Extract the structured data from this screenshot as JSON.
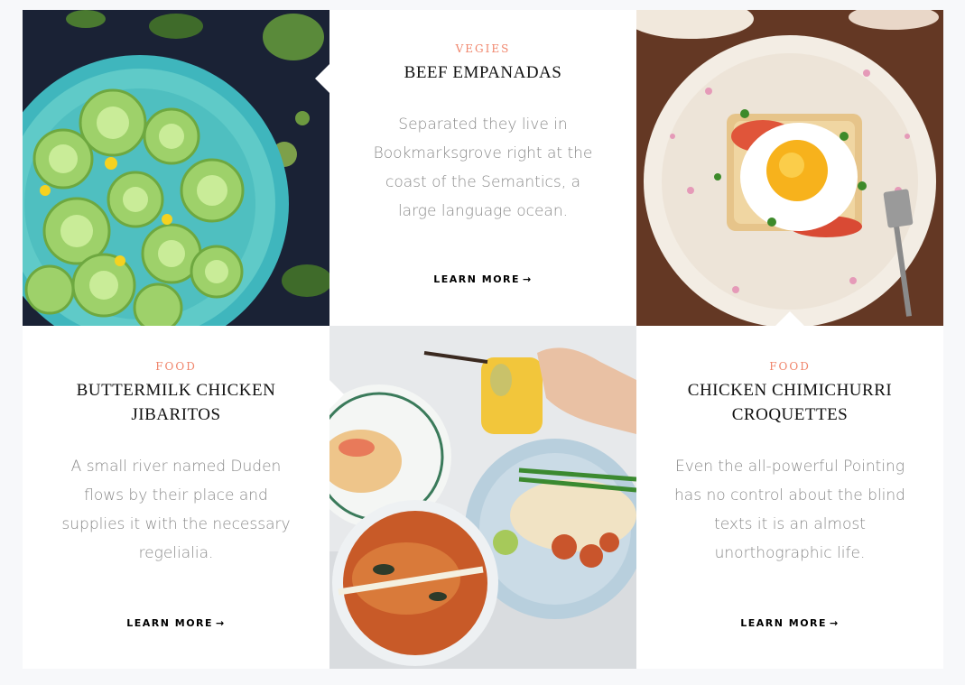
{
  "cards": [
    {
      "category": "Vegies",
      "title": "Beef Empanadas",
      "description": "Separated they live in Bookmarksgrove right at the coast of the Semantics, a large language ocean.",
      "link_label": "Learn More",
      "arrow": "→"
    },
    {
      "category": "Food",
      "title": "Buttermilk Chicken Jibaritos",
      "description": "A small river named Duden flows by their place and supplies it with the necessary regelialia.",
      "link_label": "Learn More",
      "arrow": "→"
    },
    {
      "category": "Food",
      "title": "Chicken Chimichurri Croquettes",
      "description": "Even the all-powerful Pointing has no control about the blind texts it is an almost unorthographic life.",
      "link_label": "Learn More",
      "arrow": "→"
    }
  ],
  "images": [
    {
      "name": "green-tomatoes-plate-image",
      "subject": "sliced green tomatoes on teal plate"
    },
    {
      "name": "fried-egg-toast-image",
      "subject": "fried egg on toast on floral plate"
    },
    {
      "name": "thai-dishes-image",
      "subject": "noodle bowls, curry and drink"
    }
  ],
  "colors": {
    "accent": "#f0856b",
    "background": "#f7f8fa",
    "card": "#ffffff"
  }
}
